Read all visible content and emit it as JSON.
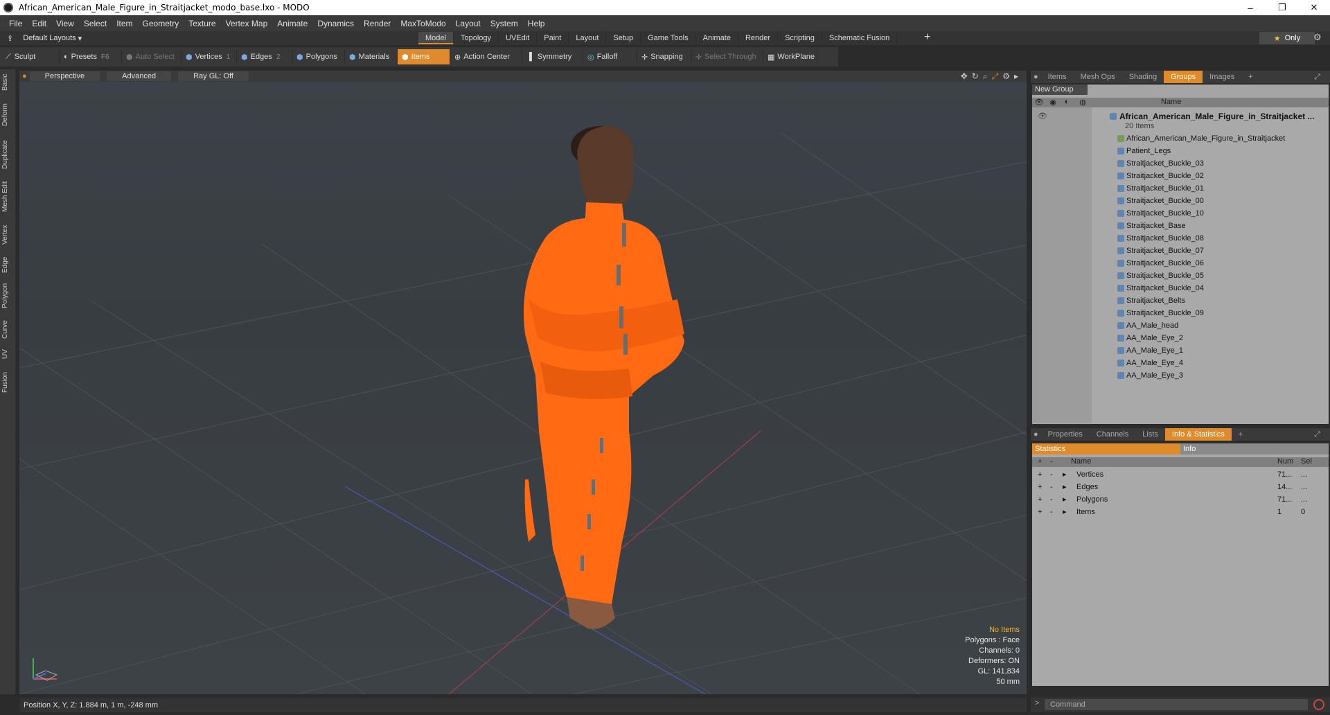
{
  "window": {
    "title": "African_American_Male_Figure_in_Straitjacket_modo_base.lxo - MODO",
    "controls": [
      "–",
      "❐",
      "✕"
    ]
  },
  "menu": [
    "File",
    "Edit",
    "View",
    "Select",
    "Item",
    "Geometry",
    "Texture",
    "Vertex Map",
    "Animate",
    "Dynamics",
    "Render",
    "MaxToModo",
    "Layout",
    "System",
    "Help"
  ],
  "layout_selector": "Default Layouts",
  "mode_tabs": [
    "Model",
    "Topology",
    "UVEdit",
    "Paint",
    "Layout",
    "Setup",
    "Game Tools",
    "Animate",
    "Render",
    "Scripting",
    "Schematic Fusion"
  ],
  "active_mode": "Model",
  "only_label": "Only",
  "toolbar": {
    "sculpt": "Sculpt",
    "presets": "Presets",
    "presets_key": "F6",
    "auto_select": "Auto Select",
    "vertices": "Vertices",
    "vertices_key": "1",
    "edges": "Edges",
    "edges_key": "2",
    "polygons": "Polygons",
    "materials": "Materials",
    "items": "Items",
    "action_center": "Action Center",
    "symmetry": "Symmetry",
    "falloff": "Falloff",
    "snapping": "Snapping",
    "select_through": "Select Through",
    "workplane": "WorkPlane"
  },
  "left_tabs": [
    "Basic",
    "Deform",
    "Duplicate",
    "Mesh Edit",
    "Vertex",
    "Edge",
    "Polygon",
    "Curve",
    "UV",
    "Fusion"
  ],
  "viewport": {
    "view": "Perspective",
    "shading": "Advanced",
    "raygl": "Ray GL: Off",
    "info": {
      "selection": "No Items",
      "polygons": "Polygons : Face",
      "channels": "Channels: 0",
      "deformers": "Deformers: ON",
      "gl": "GL: 141,834",
      "focal": "50 mm"
    }
  },
  "status": {
    "position": "Position X, Y, Z:  1.884 m, 1 m, -248 mm"
  },
  "top_panel": {
    "tabs": [
      "Items",
      "Mesh Ops",
      "Shading",
      "Groups",
      "Images"
    ],
    "active_tab": "Groups",
    "new_group": "New Group",
    "name_col": "Name",
    "group": {
      "name": "African_American_Male_Figure_in_Straitjacket ...",
      "count": "20 Items"
    },
    "items": [
      "African_American_Male_Figure_in_Straitjacket",
      "Patient_Legs",
      "Straitjacket_Buckle_03",
      "Straitjacket_Buckle_02",
      "Straitjacket_Buckle_01",
      "Straitjacket_Buckle_00",
      "Straitjacket_Buckle_10",
      "Straitjacket_Base",
      "Straitjacket_Buckle_08",
      "Straitjacket_Buckle_07",
      "Straitjacket_Buckle_06",
      "Straitjacket_Buckle_05",
      "Straitjacket_Buckle_04",
      "Straitjacket_Belts",
      "Straitjacket_Buckle_09",
      "AA_Male_head",
      "AA_Male_Eye_2",
      "AA_Male_Eye_1",
      "AA_Male_Eye_4",
      "AA_Male_Eye_3"
    ]
  },
  "bottom_panel": {
    "tabs": [
      "Properties",
      "Channels",
      "Lists",
      "Info & Statistics"
    ],
    "active_tab": "Info & Statistics",
    "subtabs": [
      "Statistics",
      "Info"
    ],
    "cols": [
      "Name",
      "Num",
      "Sel"
    ],
    "rows": [
      {
        "name": "Vertices",
        "num": "71...",
        "sel": "..."
      },
      {
        "name": "Edges",
        "num": "14...",
        "sel": "..."
      },
      {
        "name": "Polygons",
        "num": "71...",
        "sel": "..."
      },
      {
        "name": "Items",
        "num": "1",
        "sel": "0"
      }
    ]
  },
  "command": {
    "placeholder": "Command"
  },
  "colors": {
    "accent": "#e08b2b",
    "highlight": "#f0b429",
    "figure": "#ff6a13"
  }
}
